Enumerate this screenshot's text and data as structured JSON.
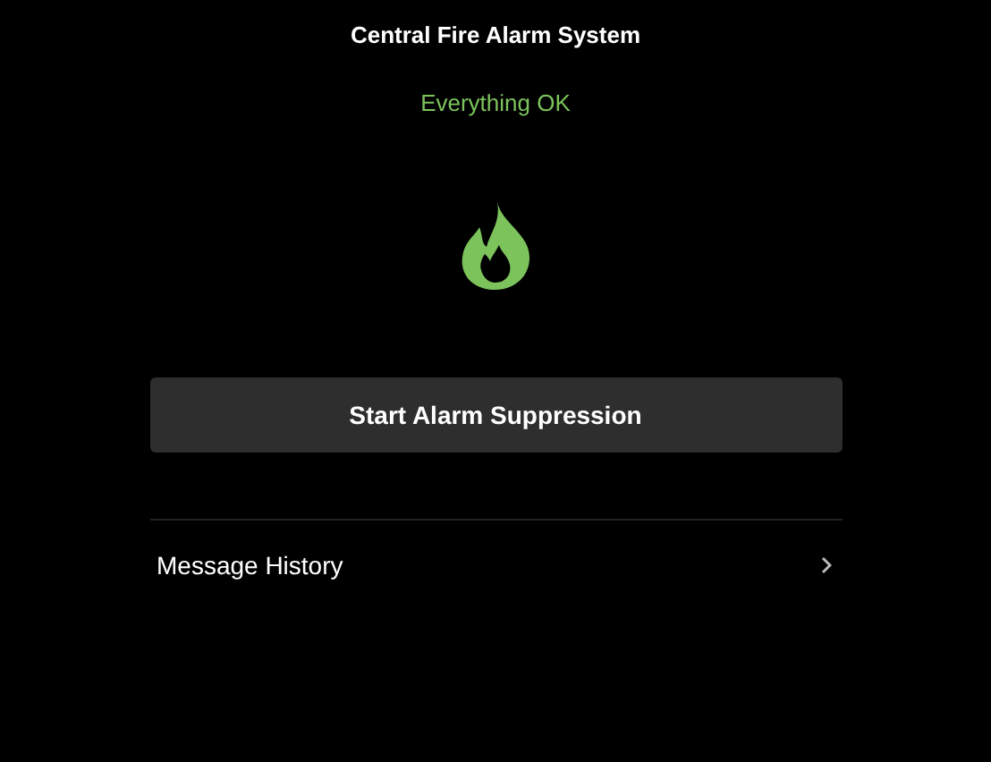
{
  "title": "Central Fire Alarm System",
  "status": {
    "text": "Everything OK",
    "kind": "ok"
  },
  "action_button": {
    "label": "Start Alarm Suppression"
  },
  "menu_items": [
    {
      "label": "Message History"
    }
  ]
}
